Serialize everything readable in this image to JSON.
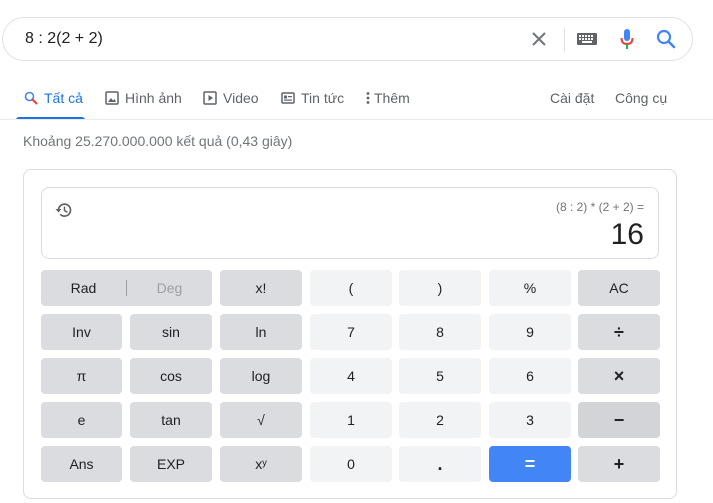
{
  "search": {
    "query": "8 : 2(2 + 2)"
  },
  "icons": {
    "clear": "close-icon",
    "keyboard": "keyboard-icon",
    "mic": "microphone-icon",
    "search": "search-icon"
  },
  "tabs": [
    {
      "label": "Tất cả",
      "icon": "search-icon",
      "active": true
    },
    {
      "label": "Hình ảnh",
      "icon": "image-icon"
    },
    {
      "label": "Video",
      "icon": "video-icon"
    },
    {
      "label": "Tin tức",
      "icon": "news-icon"
    },
    {
      "label": "Thêm",
      "icon": "more-vert-icon"
    }
  ],
  "tools": {
    "settings": "Cài đặt",
    "tools": "Công cụ"
  },
  "stats": "Khoảng 25.270.000.000 kết quả (0,43 giây)",
  "calculator": {
    "expression": "(8 : 2) * (2 + 2) =",
    "result": "16",
    "rad": "Rad",
    "deg": "Deg",
    "buttons": {
      "factorial": "x!",
      "lparen": "(",
      "rparen": ")",
      "percent": "%",
      "ac": "AC",
      "inv": "Inv",
      "sin": "sin",
      "ln": "ln",
      "n7": "7",
      "n8": "8",
      "n9": "9",
      "divide": "÷",
      "pi": "π",
      "cos": "cos",
      "log": "log",
      "n4": "4",
      "n5": "5",
      "n6": "6",
      "multiply": "×",
      "e": "e",
      "tan": "tan",
      "sqrt": "√",
      "n1": "1",
      "n2": "2",
      "n3": "3",
      "minus": "−",
      "ans": "Ans",
      "exp": "EXP",
      "power": "xʸ",
      "n0": "0",
      "dot": ".",
      "equals": "=",
      "plus": "+"
    }
  },
  "colors": {
    "accent": "#1a73e8",
    "equals_button": "#4285f4"
  }
}
